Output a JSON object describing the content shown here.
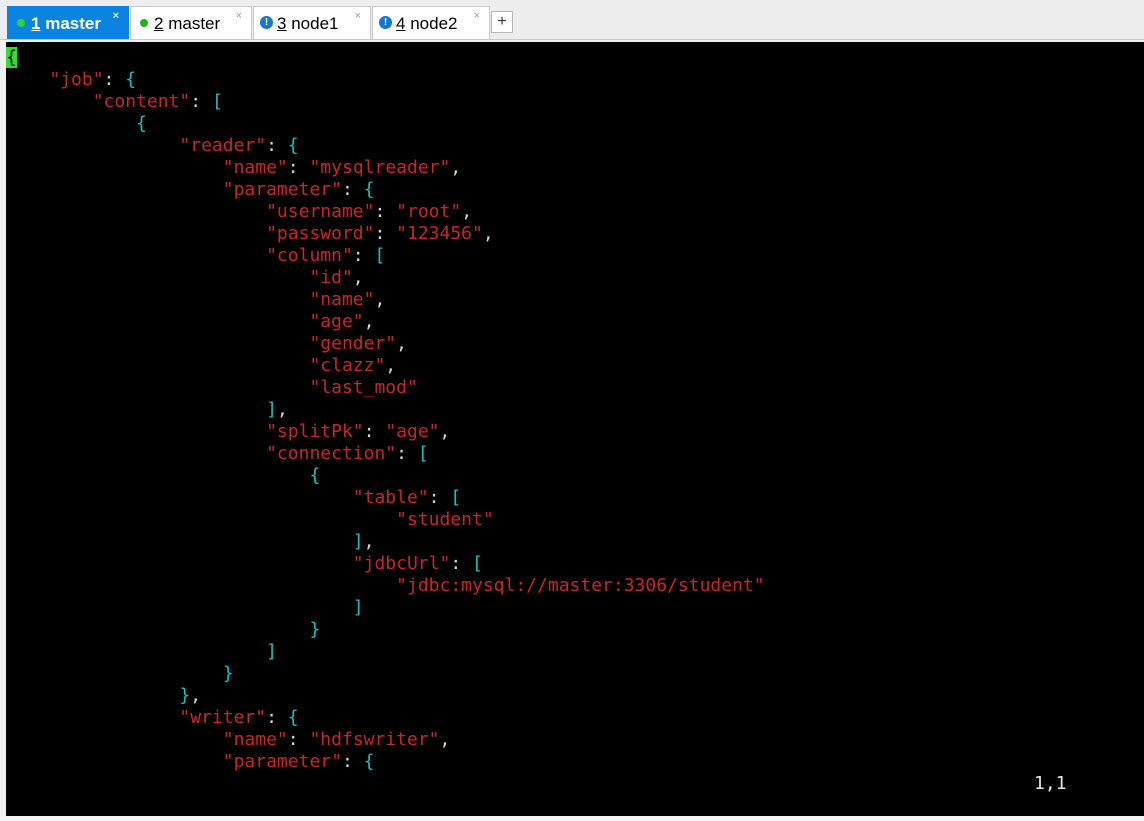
{
  "tabs": [
    {
      "num": "1",
      "title": "master",
      "status": "connected",
      "active": true,
      "close": "×"
    },
    {
      "num": "2",
      "title": "master",
      "status": "connected",
      "active": false,
      "close": "×"
    },
    {
      "num": "3",
      "title": "node1",
      "status": "warning",
      "active": false,
      "close": "×"
    },
    {
      "num": "4",
      "title": "node2",
      "status": "warning",
      "active": false,
      "close": "×"
    }
  ],
  "new_tab_label": "+",
  "status_icons": {
    "connected": "green-dot-icon",
    "warning": "exclamation-icon",
    "warning_glyph": "!"
  },
  "cursor_position": "1,1",
  "colors": {
    "accent": "#0a84e0",
    "key": "#c8262b",
    "bracket": "#19c2c2",
    "cursor": "#2fe02f"
  },
  "lines": [
    [
      {
        "t": "{",
        "c": "cursor"
      }
    ],
    [
      {
        "t": "    ",
        "c": "p"
      },
      {
        "t": "\"job\"",
        "c": "k"
      },
      {
        "t": ": ",
        "c": "p"
      },
      {
        "t": "{",
        "c": "b"
      }
    ],
    [
      {
        "t": "        ",
        "c": "p"
      },
      {
        "t": "\"content\"",
        "c": "k"
      },
      {
        "t": ": ",
        "c": "p"
      },
      {
        "t": "[",
        "c": "b"
      }
    ],
    [
      {
        "t": "            ",
        "c": "p"
      },
      {
        "t": "{",
        "c": "b"
      }
    ],
    [
      {
        "t": "                ",
        "c": "p"
      },
      {
        "t": "\"reader\"",
        "c": "k"
      },
      {
        "t": ": ",
        "c": "p"
      },
      {
        "t": "{",
        "c": "b"
      }
    ],
    [
      {
        "t": "                    ",
        "c": "p"
      },
      {
        "t": "\"name\"",
        "c": "k"
      },
      {
        "t": ": ",
        "c": "p"
      },
      {
        "t": "\"mysqlreader\"",
        "c": "k"
      },
      {
        "t": ",",
        "c": "p"
      }
    ],
    [
      {
        "t": "                    ",
        "c": "p"
      },
      {
        "t": "\"parameter\"",
        "c": "k"
      },
      {
        "t": ": ",
        "c": "p"
      },
      {
        "t": "{",
        "c": "b"
      }
    ],
    [
      {
        "t": "                        ",
        "c": "p"
      },
      {
        "t": "\"username\"",
        "c": "k"
      },
      {
        "t": ": ",
        "c": "p"
      },
      {
        "t": "\"root\"",
        "c": "k"
      },
      {
        "t": ",",
        "c": "p"
      }
    ],
    [
      {
        "t": "                        ",
        "c": "p"
      },
      {
        "t": "\"password\"",
        "c": "k"
      },
      {
        "t": ": ",
        "c": "p"
      },
      {
        "t": "\"123456\"",
        "c": "k"
      },
      {
        "t": ",",
        "c": "p"
      }
    ],
    [
      {
        "t": "                        ",
        "c": "p"
      },
      {
        "t": "\"column\"",
        "c": "k"
      },
      {
        "t": ": ",
        "c": "p"
      },
      {
        "t": "[",
        "c": "b"
      }
    ],
    [
      {
        "t": "                            ",
        "c": "p"
      },
      {
        "t": "\"id\"",
        "c": "k"
      },
      {
        "t": ",",
        "c": "p"
      }
    ],
    [
      {
        "t": "                            ",
        "c": "p"
      },
      {
        "t": "\"name\"",
        "c": "k"
      },
      {
        "t": ",",
        "c": "p"
      }
    ],
    [
      {
        "t": "                            ",
        "c": "p"
      },
      {
        "t": "\"age\"",
        "c": "k"
      },
      {
        "t": ",",
        "c": "p"
      }
    ],
    [
      {
        "t": "                            ",
        "c": "p"
      },
      {
        "t": "\"gender\"",
        "c": "k"
      },
      {
        "t": ",",
        "c": "p"
      }
    ],
    [
      {
        "t": "                            ",
        "c": "p"
      },
      {
        "t": "\"clazz\"",
        "c": "k"
      },
      {
        "t": ",",
        "c": "p"
      }
    ],
    [
      {
        "t": "                            ",
        "c": "p"
      },
      {
        "t": "\"last_mod\"",
        "c": "k"
      }
    ],
    [
      {
        "t": "                        ",
        "c": "p"
      },
      {
        "t": "]",
        "c": "b"
      },
      {
        "t": ",",
        "c": "p"
      }
    ],
    [
      {
        "t": "                        ",
        "c": "p"
      },
      {
        "t": "\"splitPk\"",
        "c": "k"
      },
      {
        "t": ": ",
        "c": "p"
      },
      {
        "t": "\"age\"",
        "c": "k"
      },
      {
        "t": ",",
        "c": "p"
      }
    ],
    [
      {
        "t": "                        ",
        "c": "p"
      },
      {
        "t": "\"connection\"",
        "c": "k"
      },
      {
        "t": ": ",
        "c": "p"
      },
      {
        "t": "[",
        "c": "b"
      }
    ],
    [
      {
        "t": "                            ",
        "c": "p"
      },
      {
        "t": "{",
        "c": "b"
      }
    ],
    [
      {
        "t": "                                ",
        "c": "p"
      },
      {
        "t": "\"table\"",
        "c": "k"
      },
      {
        "t": ": ",
        "c": "p"
      },
      {
        "t": "[",
        "c": "b"
      }
    ],
    [
      {
        "t": "                                    ",
        "c": "p"
      },
      {
        "t": "\"student\"",
        "c": "k"
      }
    ],
    [
      {
        "t": "                                ",
        "c": "p"
      },
      {
        "t": "]",
        "c": "b"
      },
      {
        "t": ",",
        "c": "p"
      }
    ],
    [
      {
        "t": "                                ",
        "c": "p"
      },
      {
        "t": "\"jdbcUrl\"",
        "c": "k"
      },
      {
        "t": ": ",
        "c": "p"
      },
      {
        "t": "[",
        "c": "b"
      }
    ],
    [
      {
        "t": "                                    ",
        "c": "p"
      },
      {
        "t": "\"jdbc:mysql://master:3306/student\"",
        "c": "k"
      }
    ],
    [
      {
        "t": "                                ",
        "c": "p"
      },
      {
        "t": "]",
        "c": "b"
      }
    ],
    [
      {
        "t": "                            ",
        "c": "p"
      },
      {
        "t": "}",
        "c": "b"
      }
    ],
    [
      {
        "t": "                        ",
        "c": "p"
      },
      {
        "t": "]",
        "c": "b"
      }
    ],
    [
      {
        "t": "                    ",
        "c": "p"
      },
      {
        "t": "}",
        "c": "b"
      }
    ],
    [
      {
        "t": "                ",
        "c": "p"
      },
      {
        "t": "}",
        "c": "b"
      },
      {
        "t": ",",
        "c": "p"
      }
    ],
    [
      {
        "t": "                ",
        "c": "p"
      },
      {
        "t": "\"writer\"",
        "c": "k"
      },
      {
        "t": ": ",
        "c": "p"
      },
      {
        "t": "{",
        "c": "b"
      }
    ],
    [
      {
        "t": "                    ",
        "c": "p"
      },
      {
        "t": "\"name\"",
        "c": "k"
      },
      {
        "t": ": ",
        "c": "p"
      },
      {
        "t": "\"hdfswriter\"",
        "c": "k"
      },
      {
        "t": ",",
        "c": "p"
      }
    ],
    [
      {
        "t": "                    ",
        "c": "p"
      },
      {
        "t": "\"parameter\"",
        "c": "k"
      },
      {
        "t": ": ",
        "c": "p"
      },
      {
        "t": "{",
        "c": "b"
      }
    ]
  ]
}
